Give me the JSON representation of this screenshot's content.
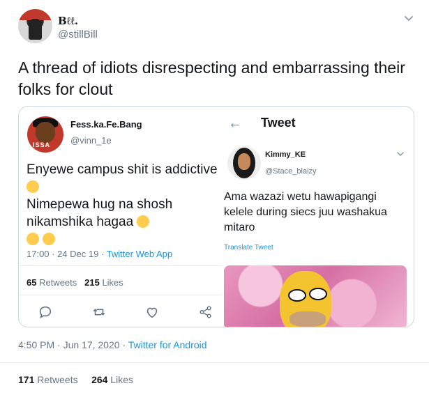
{
  "header": {
    "display_name": "Bℓℓ.",
    "handle": "@stillBill"
  },
  "tweet": {
    "text": "A thread of idiots disrespecting and embarrassing their folks for clout"
  },
  "quote_left": {
    "avatar_tag": "ISSA",
    "name": "Fess.ka.Fe.Bang",
    "handle": "@vinn_1e",
    "line1": "Enyewe campus shit is addictive",
    "line2": "Nimepewa hug na shosh",
    "line3": "nikamshika hagaa",
    "meta": "17:00 · 24 Dec 19 · ",
    "source": "Twitter Web App",
    "retweets": "65",
    "retweets_label": " Retweets",
    "likes": "215",
    "likes_label": " Likes"
  },
  "quote_right": {
    "back": "←",
    "title": "Tweet",
    "name": "Kimmy_KE",
    "handle": "@Stace_blaizy",
    "text": "Ama wazazi wetu hawapigangi kelele during siecs juu washakua mitaro",
    "translate": "Translate Tweet"
  },
  "footer": {
    "meta": "4:50 PM · Jun 17, 2020 · ",
    "source": "Twitter for Android",
    "retweets": "171",
    "retweets_label": " Retweets",
    "likes": "264",
    "likes_label": " Likes"
  },
  "colors": {
    "link": "#1b95e0",
    "muted": "#657786",
    "border": "#ccd6dd"
  }
}
